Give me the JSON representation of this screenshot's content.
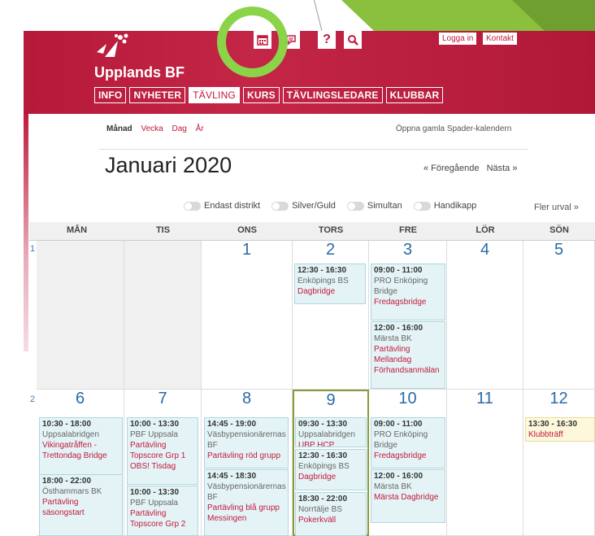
{
  "header": {
    "brand": "Upplands BF",
    "nav": [
      {
        "label": "INFO",
        "active": false
      },
      {
        "label": "NYHETER",
        "active": false
      },
      {
        "label": "TÄVLING",
        "active": true
      },
      {
        "label": "KURS",
        "active": false
      },
      {
        "label": "TÄVLINGSLEDARE",
        "active": false
      },
      {
        "label": "KLUBBAR",
        "active": false
      }
    ],
    "icons": [
      "calendar-icon",
      "chat-icon",
      "help-icon",
      "search-icon"
    ],
    "help_glyph": "?",
    "login_label": "Logga in",
    "contact_label": "Kontakt",
    "brand_color": "#c01a3c",
    "highlight_color": "#8bd44a"
  },
  "views": {
    "month": "Månad",
    "week": "Vecka",
    "day": "Dag",
    "year": "År",
    "old_calendar": "Öppna gamla Spader-kalendern"
  },
  "title": "Januari 2020",
  "pager": {
    "prev": "« Föregående",
    "next": "Nästa »"
  },
  "filters": {
    "district": "Endast distrikt",
    "silver": "Silver/Guld",
    "simultan": "Simultan",
    "handicap": "Handikapp",
    "more": "Fler urval »"
  },
  "weekdays": [
    "MÅN",
    "TIS",
    "ONS",
    "TORS",
    "FRE",
    "LÖR",
    "SÖN"
  ],
  "weeks": [
    {
      "week": "1",
      "days": [
        "",
        "",
        "1",
        "2",
        "3",
        "4",
        "5"
      ],
      "events": {
        "thu": [
          {
            "time": "12:30 - 16:30",
            "org": "Enköpings BS",
            "cat": "Dagbridge"
          }
        ],
        "fri": [
          {
            "time": "09:00 - 11:00",
            "org": "PRO Enköping Bridge",
            "cat": "Fredagsbridge"
          },
          {
            "time": "12:00 - 16:00",
            "org": "Märsta BK",
            "cat": "Partävling Mellandag Förhandsanmälan"
          }
        ]
      }
    },
    {
      "week": "2",
      "days": [
        "6",
        "7",
        "8",
        "9",
        "10",
        "11",
        "12"
      ],
      "events": {
        "mon": [
          {
            "time": "10:30 - 18:00",
            "org": "Uppsalabridgen",
            "cat": "Vikingatråffen - Trettondag Bridge"
          },
          {
            "time": "18:00 - 22:00",
            "org": "Östhammars BK",
            "cat": "Partävling säsongstart"
          }
        ],
        "tue": [
          {
            "time": "10:00 - 13:30",
            "org": "PBF Uppsala",
            "cat": "Partävling Topscore Grp 1 OBS! Tisdag"
          },
          {
            "time": "10:00 - 13:30",
            "org": "PBF Uppsala",
            "cat": "Partävling Topscore Grp 2"
          }
        ],
        "wed": [
          {
            "time": "14:45 - 19:00",
            "org": "Väsbypensionärernas BF",
            "cat": "Partävling röd grupp"
          },
          {
            "time": "14:45 - 18:30",
            "org": "Väsbypensionärernas BF",
            "cat": "Partävling blå grupp Messingen"
          }
        ],
        "thu": [
          {
            "time": "09:30 - 13:30",
            "org": "Uppsalabridgen",
            "cat": "UBP HCP"
          },
          {
            "time": "12:30 - 16:30",
            "org": "Enköpings BS",
            "cat": "Dagbridge"
          },
          {
            "time": "18:30 - 22:00",
            "org": "Norrtälje BS",
            "cat": "Pokerkväll"
          }
        ],
        "fri": [
          {
            "time": "09:00 - 11:00",
            "org": "PRO Enköping Bridge",
            "cat": "Fredagsbridge"
          },
          {
            "time": "12:00 - 16:00",
            "org": "Märsta BK",
            "cat": "Märsta Dagbridge"
          }
        ],
        "sun": [
          {
            "time": "13:30 - 16:30",
            "org": "",
            "cat": "Klubbträff"
          }
        ]
      }
    }
  ]
}
